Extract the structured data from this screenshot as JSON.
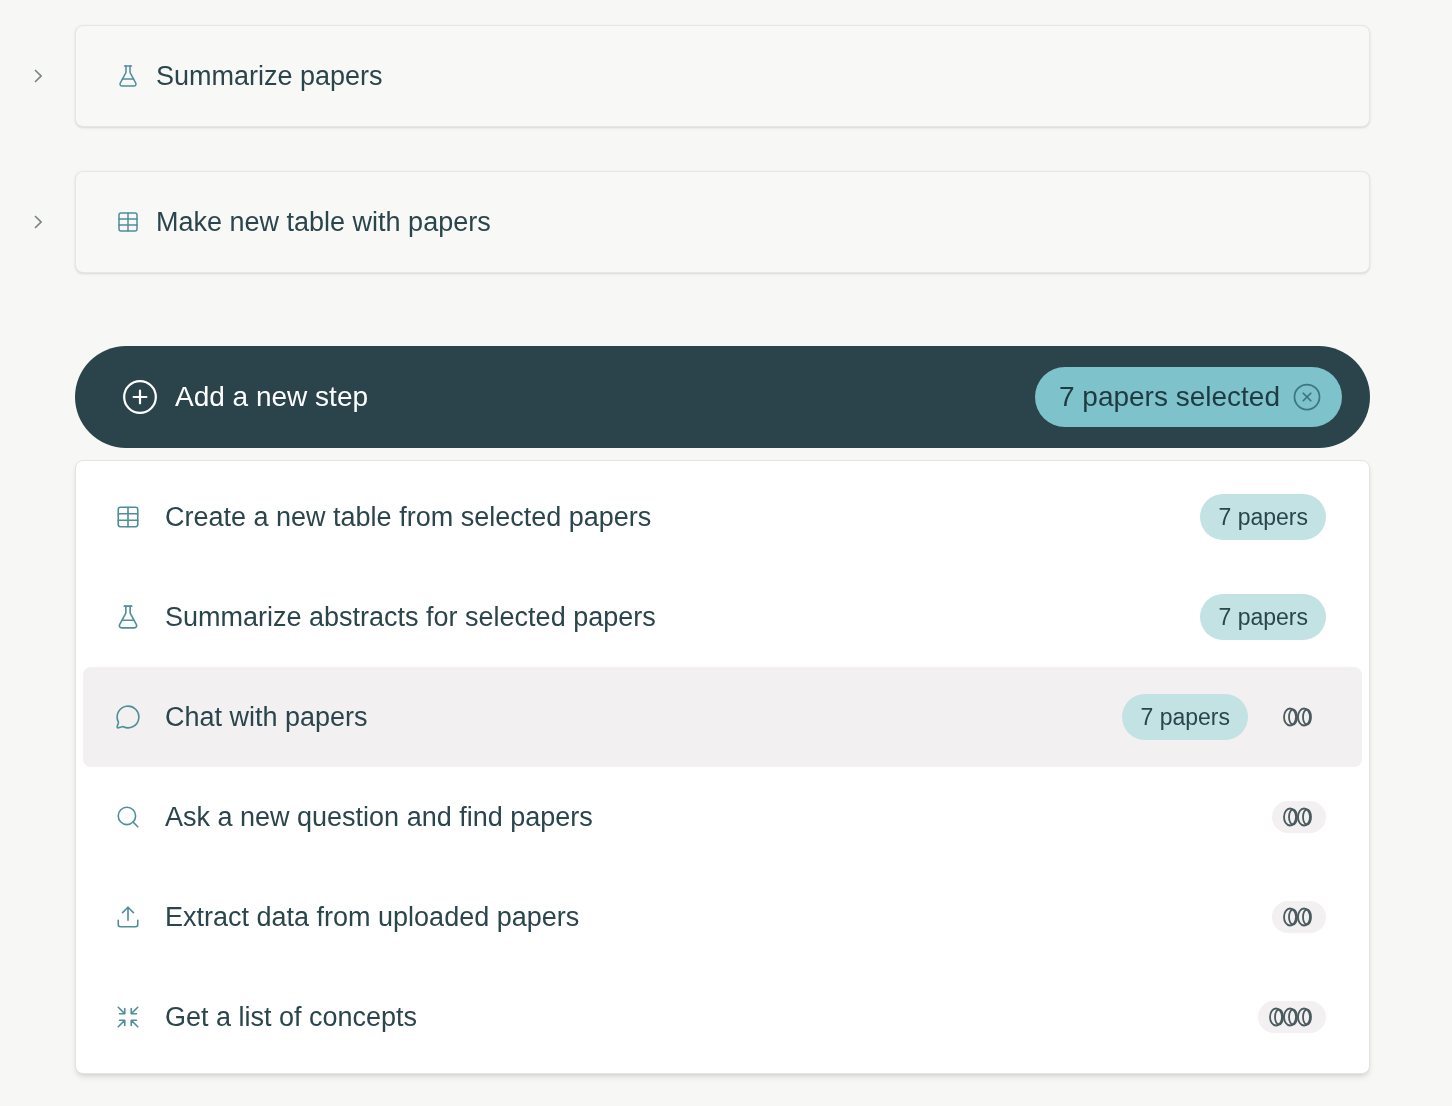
{
  "steps": [
    {
      "kind": "flask",
      "label": "Summarize papers",
      "expanded": false
    },
    {
      "kind": "table",
      "label": "Make new table with papers",
      "expanded": false
    }
  ],
  "add_step": {
    "label": "Add a new step",
    "selection": "7 papers selected"
  },
  "options": [
    {
      "kind": "table",
      "label": "Create a new table from selected papers",
      "badge": "7 papers",
      "selected": false
    },
    {
      "kind": "flask",
      "label": "Summarize abstracts for selected papers",
      "badge": "7 papers",
      "selected": false
    },
    {
      "kind": "chat",
      "label": "Chat with papers",
      "badge": "7 papers",
      "cost": {
        "kind": "two-coins"
      },
      "selected": true
    },
    {
      "kind": "search",
      "label": "Ask a new question and find papers",
      "cost": {
        "kind": "two-coins"
      },
      "selected": false
    },
    {
      "kind": "upload",
      "label": "Extract data from uploaded papers",
      "cost": {
        "kind": "two-coins"
      },
      "selected": false
    },
    {
      "kind": "compress",
      "label": "Get a list of concepts",
      "cost": {
        "kind": "three-coins"
      },
      "selected": false
    }
  ]
}
